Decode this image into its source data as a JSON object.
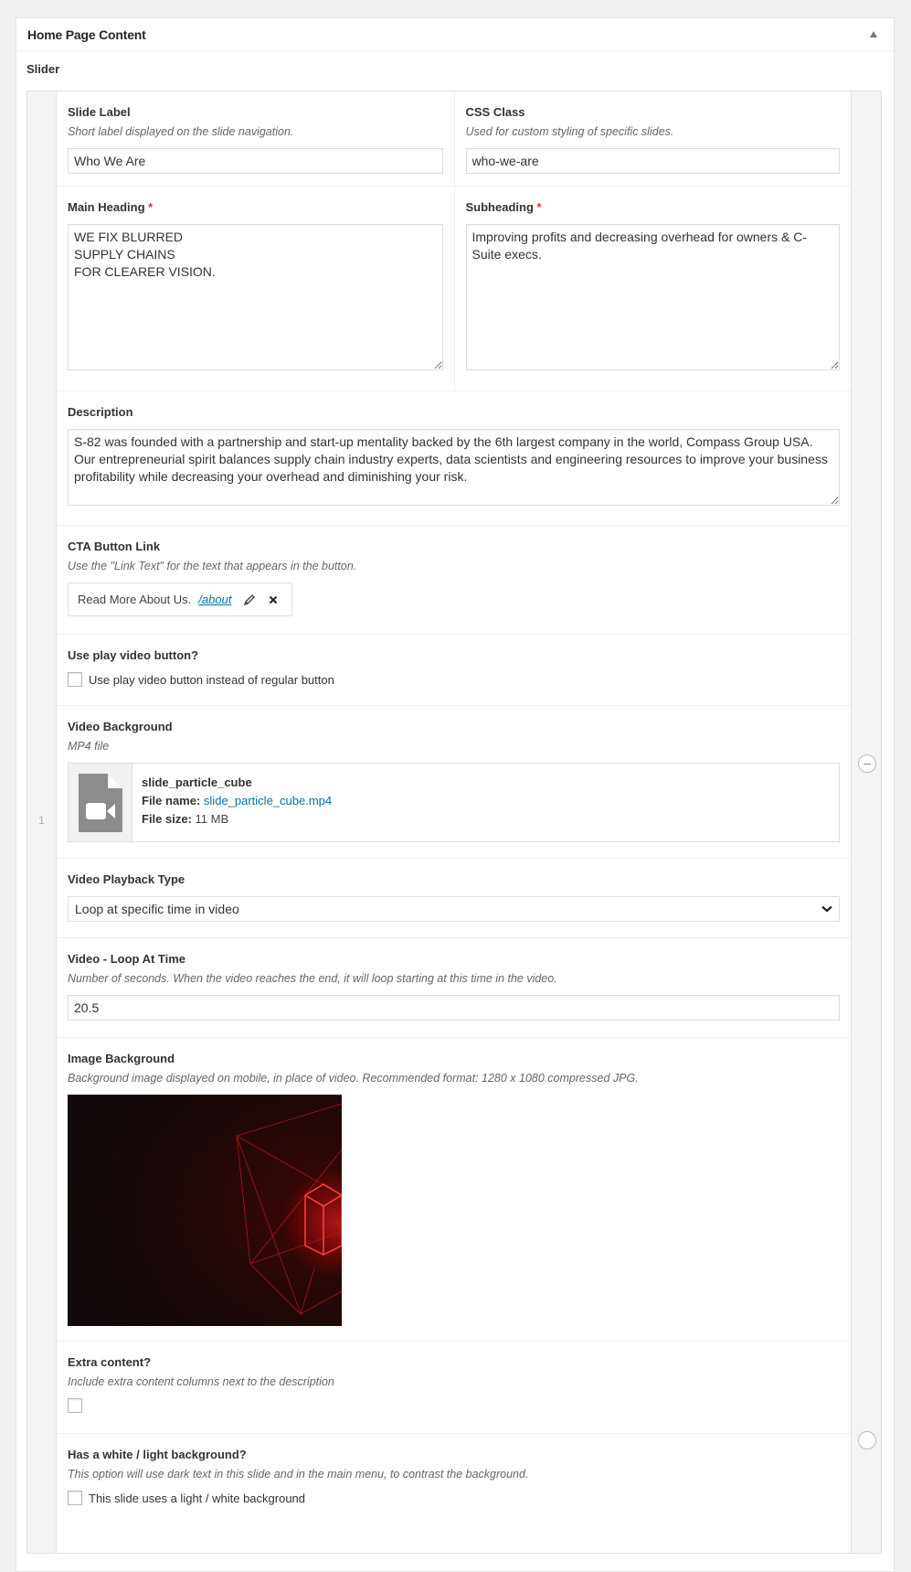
{
  "postbox": {
    "title": "Home Page Content",
    "toggle_icon": "triangle-up-icon"
  },
  "slider": {
    "label": "Slider",
    "row_number": "1",
    "fields": {
      "slide_label": {
        "label": "Slide Label",
        "description": "Short label displayed on the slide navigation.",
        "value": "Who We Are"
      },
      "css_class": {
        "label": "CSS Class",
        "description": "Used for custom styling of specific slides.",
        "value": "who-we-are"
      },
      "main_heading": {
        "label": "Main Heading",
        "required_mark": "*",
        "value": "WE FIX BLURRED\nSUPPLY CHAINS\nFOR CLEARER VISION."
      },
      "subheading": {
        "label": "Subheading",
        "required_mark": "*",
        "value": "Improving profits and decreasing overhead for owners & C-Suite execs."
      },
      "description": {
        "label": "Description",
        "value": "S-82 was founded with a partnership and start-up mentality backed by the 6th largest company in the world, Compass Group USA. Our entrepreneurial spirit balances supply chain industry experts, data scientists and engineering resources to improve your business profitability while decreasing your overhead and diminishing your risk."
      },
      "cta_button_link": {
        "label": "CTA Button Link",
        "description": "Use the \"Link Text\" for the text that appears in the button.",
        "link_text": "Read More About Us.",
        "link_url": "/about",
        "edit_icon": "pencil-icon",
        "remove_icon": "close-icon"
      },
      "use_play_video": {
        "label": "Use play video button?",
        "checkbox_label": "Use play video button instead of regular button",
        "checked": false
      },
      "video_background": {
        "label": "Video Background",
        "description": "MP4 file",
        "file_title": "slide_particle_cube",
        "file_name_label": "File name:",
        "file_name": "slide_particle_cube.mp4",
        "file_size_label": "File size:",
        "file_size": "11 MB",
        "icon": "video-file-icon"
      },
      "video_playback_type": {
        "label": "Video Playback Type",
        "selected": "Loop at specific time in video"
      },
      "video_loop_at_time": {
        "label": "Video - Loop At Time",
        "description": "Number of seconds. When the video reaches the end, it will loop starting at this time in the video.",
        "value": "20.5"
      },
      "image_background": {
        "label": "Image Background",
        "description": "Background image displayed on mobile, in place of video. Recommended format: 1280 x 1080 compressed JPG."
      },
      "extra_content": {
        "label": "Extra content?",
        "description": "Include extra content columns next to the description",
        "checked": false
      },
      "light_background": {
        "label": "Has a white / light background?",
        "description": "This option will use dark text in this slide and in the main menu, to contrast the background.",
        "checkbox_label": "This slide uses a light / white background",
        "checked": false
      }
    }
  }
}
